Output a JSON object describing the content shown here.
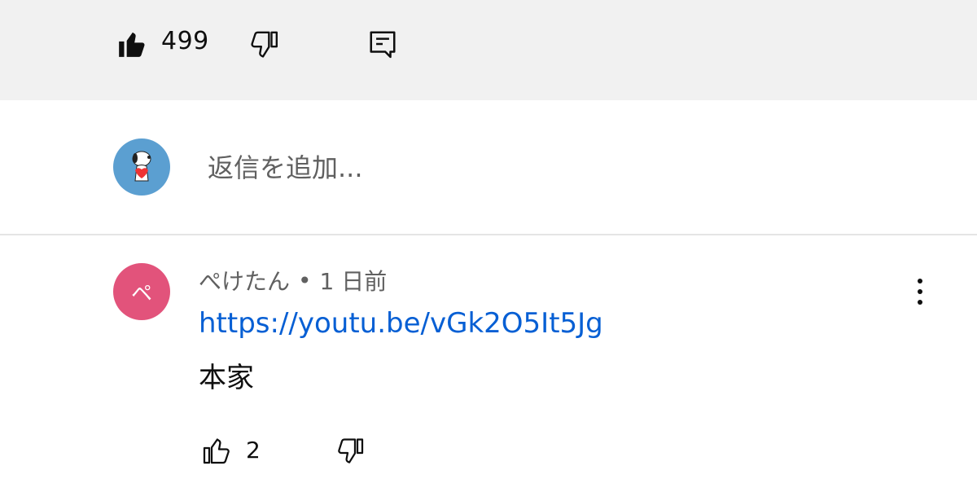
{
  "top_actions": {
    "like_count": "499",
    "like_icon": "thumbs-up-filled-icon",
    "dislike_icon": "thumbs-down-icon",
    "reply_icon": "comment-icon"
  },
  "reply_box": {
    "placeholder": "返信を追加..."
  },
  "comment": {
    "author": "ぺけたん",
    "separator": "•",
    "time": "1 日前",
    "avatar_text": "ペ",
    "link": "https://youtu.be/vGk2O5It5Jg",
    "text": "本家",
    "like_count": "2"
  },
  "colors": {
    "top_bar": "#f1f1f1",
    "link": "#065fd4",
    "commenter_avatar": "#e2537b",
    "user_avatar": "#5b9fd1"
  }
}
